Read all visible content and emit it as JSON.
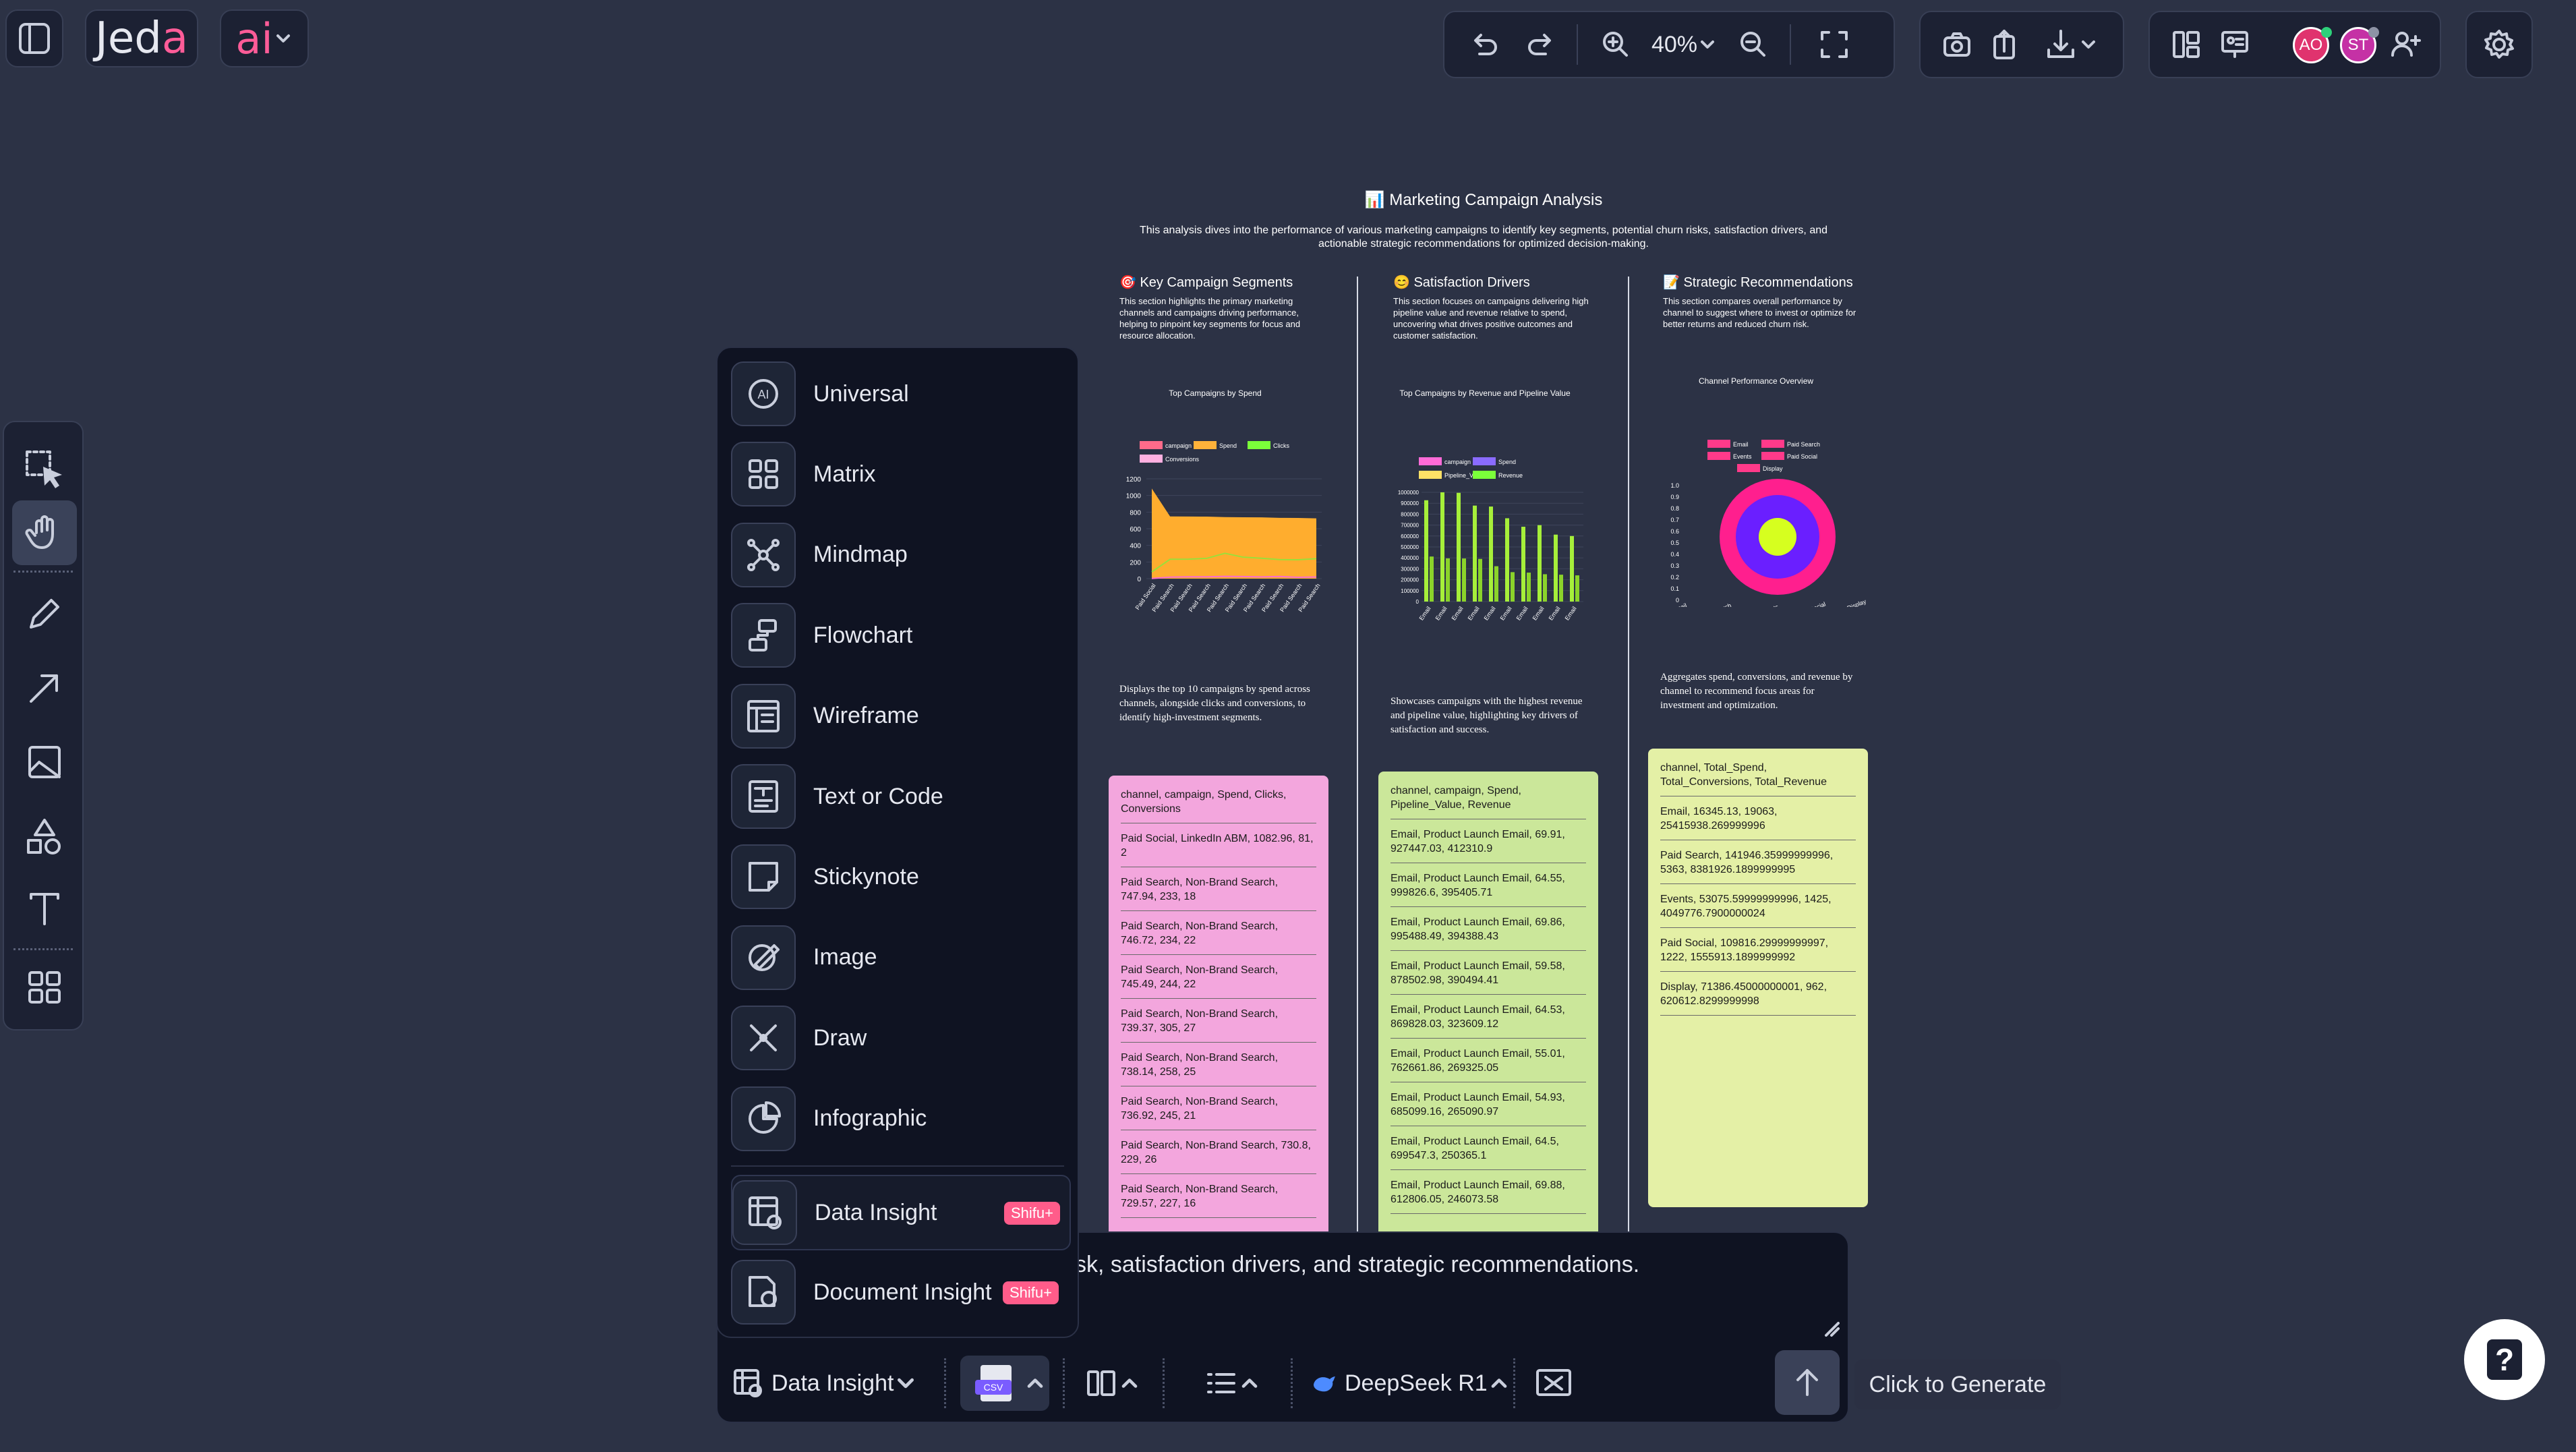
{
  "app": {
    "logo": "Jeda",
    "logo_accent": "a",
    "logo_main": "Jed",
    "ai_label": "ai"
  },
  "topbar": {
    "zoom_value": "40%",
    "avatars": [
      {
        "initials": "AO",
        "color": "#e0336e"
      },
      {
        "initials": "ST",
        "color": "#c531a5"
      }
    ]
  },
  "document": {
    "title_icon": "📊",
    "title": "Marketing Campaign Analysis",
    "intro": "This analysis dives into the performance of various marketing campaigns to identify key segments, potential churn risks, satisfaction drivers, and actionable strategic recommendations for optimized decision-making.",
    "columns": [
      {
        "icon": "🎯",
        "title": "Key Campaign Segments",
        "description": "This section highlights the primary marketing channels and campaigns driving performance, helping to pinpoint key segments for focus and resource allocation.",
        "chart_title": "Top Campaigns by Spend",
        "note": "Displays the top 10 campaigns by spend across channels, alongside clicks and conversions, to identify high-investment segments.",
        "sticky_color": "#f3a6dd",
        "rows": [
          "channel, campaign, Spend, Clicks, Conversions",
          "Paid Social, LinkedIn ABM, 1082.96, 81, 2",
          "Paid Search, Non-Brand Search, 747.94, 233, 18",
          "Paid Search, Non-Brand Search, 746.72, 234, 22",
          "Paid Search, Non-Brand Search, 745.49, 244, 22",
          "Paid Search, Non-Brand Search, 739.37, 305, 27",
          "Paid Search, Non-Brand Search, 738.14, 258, 25",
          "Paid Search, Non-Brand Search, 736.92, 245, 21",
          "Paid Search, Non-Brand Search, 730.8, 229, 26",
          "Paid Search, Non-Brand Search, 729.57, 227, 16"
        ]
      },
      {
        "icon": "😊",
        "title": "Satisfaction Drivers",
        "description": "This section focuses on campaigns delivering high pipeline value and revenue relative to spend, uncovering what drives positive outcomes and customer satisfaction.",
        "chart_title": "Top Campaigns by Revenue and Pipeline Value",
        "note": "Showcases campaigns with the highest revenue and pipeline value, highlighting key drivers of satisfaction and success.",
        "sticky_color": "#cbe79a",
        "rows": [
          "channel, campaign, Spend, Pipeline_Value, Revenue",
          "Email, Product Launch Email, 69.91, 927447.03, 412310.9",
          "Email, Product Launch Email, 64.55, 999826.6, 395405.71",
          "Email, Product Launch Email, 69.86, 995488.49, 394388.43",
          "Email, Product Launch Email, 59.58, 878502.98, 390494.41",
          "Email, Product Launch Email, 64.53, 869828.03, 323609.12",
          "Email, Product Launch Email, 55.01, 762661.86, 269325.05",
          "Email, Product Launch Email, 54.93, 685099.16, 265090.97",
          "Email, Product Launch Email, 64.5, 699547.3, 250365.1",
          "Email, Product Launch Email, 69.88, 612806.05, 246073.58"
        ]
      },
      {
        "icon": "📝",
        "title": "Strategic Recommendations",
        "description": "This section compares overall performance by channel to suggest where to invest or optimize for better returns and reduced churn risk.",
        "chart_title": "Channel Performance Overview",
        "note": "Aggregates spend, conversions, and revenue by channel to recommend focus areas for investment and optimization.",
        "sticky_color": "#e4f0a6",
        "rows": [
          "channel, Total_Spend, Total_Conversions, Total_Revenue",
          "Email, 16345.13, 19063, 25415938.269999996",
          "Paid Search, 141946.35999999996, 5363, 8381926.1899999995",
          "Events, 53075.59999999996, 1425, 4049776.7900000024",
          "Paid Social, 109816.29999999997, 1222, 1555913.1899999992",
          "Display, 71386.45000000001, 962, 620612.8299999998"
        ]
      }
    ]
  },
  "chart_data": [
    {
      "type": "area",
      "title": "Top Campaigns by Spend",
      "legend": [
        "campaign",
        "Spend",
        "Clicks",
        "Conversions"
      ],
      "legend_colors": [
        "#ff6b8a",
        "#ffb23a",
        "#7bff3a",
        "#ffb0e0"
      ],
      "categories": [
        "Paid Social",
        "Paid Search",
        "Paid Search",
        "Paid Search",
        "Paid Search",
        "Paid Search",
        "Paid Search",
        "Paid Search",
        "Paid Search",
        "Paid Search"
      ],
      "ylim": [
        0,
        1200
      ],
      "yticks": [
        "1200",
        "1000",
        "800",
        "600",
        "400",
        "200",
        "0"
      ],
      "series": [
        {
          "name": "Spend",
          "values": [
            1082.96,
            747.94,
            746.72,
            745.49,
            739.37,
            738.14,
            736.92,
            730.8,
            729.57,
            725
          ]
        },
        {
          "name": "Clicks",
          "values": [
            81,
            233,
            234,
            244,
            305,
            258,
            245,
            229,
            227,
            240
          ]
        },
        {
          "name": "Conversions",
          "values": [
            2,
            18,
            22,
            22,
            27,
            25,
            21,
            26,
            16,
            20
          ]
        }
      ]
    },
    {
      "type": "bar",
      "title": "Top Campaigns by Revenue and Pipeline Value",
      "legend": [
        "campaign",
        "Spend",
        "Pipeline_Value",
        "Revenue"
      ],
      "legend_colors": [
        "#ff6bd8",
        "#8a6bff",
        "#ffe066",
        "#7bff3a"
      ],
      "categories": [
        "Email",
        "Email",
        "Email",
        "Email",
        "Email",
        "Email",
        "Email",
        "Email",
        "Email",
        "Email"
      ],
      "ylim": [
        0,
        1000000
      ],
      "yticks": [
        "1000000",
        "900000",
        "800000",
        "700000",
        "600000",
        "500000",
        "400000",
        "300000",
        "200000",
        "100000",
        "0"
      ],
      "series": [
        {
          "name": "Pipeline_Value",
          "values": [
            927447.03,
            999826.6,
            995488.49,
            878502.98,
            869828.03,
            762661.86,
            685099.16,
            699547.3,
            612806.05,
            600000
          ]
        },
        {
          "name": "Revenue",
          "values": [
            412310.9,
            395405.71,
            394388.43,
            390494.41,
            323609.12,
            269325.05,
            265090.97,
            250365.1,
            246073.58,
            240000
          ]
        }
      ]
    },
    {
      "type": "pie",
      "title": "Channel Performance Overview",
      "legend": [
        "Email",
        "Paid Search",
        "Events",
        "Paid Social",
        "Display"
      ],
      "legend_colors": [
        "#ff3a8a",
        "#ff3a8a",
        "#ff3a8a",
        "#ff3a8a",
        "#ff3a8a"
      ],
      "categories": [
        "Email",
        "Paid Search",
        "Events",
        "Paid Social",
        "Display"
      ],
      "yticks": [
        "1.0",
        "0.9",
        "0.8",
        "0.7",
        "0.6",
        "0.5",
        "0.4",
        "0.3",
        "0.2",
        "0.1",
        "0"
      ],
      "rings": [
        "#ff1f8e",
        "#6a1fff",
        "#d6ff1f"
      ]
    }
  ],
  "menu": {
    "items": [
      {
        "label": "Universal",
        "icon": "ai-universal-icon"
      },
      {
        "label": "Matrix",
        "icon": "matrix-icon"
      },
      {
        "label": "Mindmap",
        "icon": "mindmap-icon"
      },
      {
        "label": "Flowchart",
        "icon": "flowchart-icon"
      },
      {
        "label": "Wireframe",
        "icon": "wireframe-icon"
      },
      {
        "label": "Text or Code",
        "icon": "text-code-icon"
      },
      {
        "label": "Stickynote",
        "icon": "stickynote-icon"
      },
      {
        "label": "Image",
        "icon": "image-icon"
      },
      {
        "label": "Draw",
        "icon": "draw-icon"
      },
      {
        "label": "Infographic",
        "icon": "infographic-icon"
      },
      {
        "label": "Data Insight",
        "icon": "data-insight-icon",
        "badge": "Shifu+"
      },
      {
        "label": "Document Insight",
        "icon": "document-insight-icon",
        "badge": "Shifu+"
      }
    ]
  },
  "prompt": {
    "text": "sk, satisfaction drivers, and strategic recommendations.",
    "mode_label": "Data Insight",
    "file_badge": "CSV",
    "model_label": "DeepSeek R1",
    "tooltip": "Click to Generate"
  },
  "help": {
    "label": "?"
  }
}
